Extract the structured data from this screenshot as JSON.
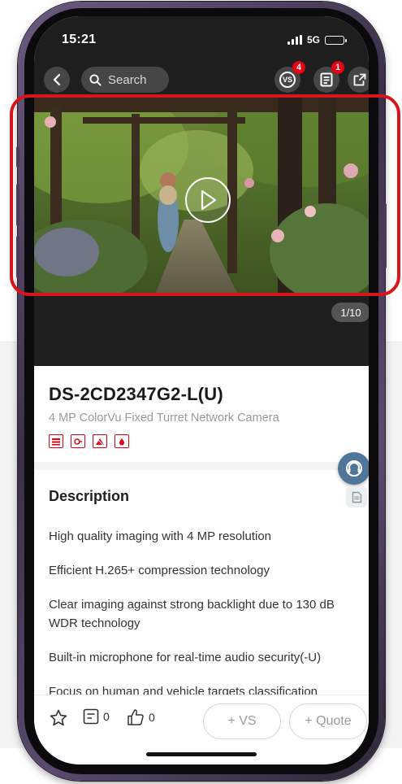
{
  "status_bar": {
    "time": "15:21",
    "network": "5G"
  },
  "nav": {
    "search_placeholder": "Search",
    "vs_badge": "4",
    "list_badge": "1"
  },
  "media": {
    "counter": "1/10"
  },
  "product": {
    "model": "DS-2CD2347G2-L(U)",
    "subtitle": "4 MP ColorVu Fixed Turret Network Camera"
  },
  "description": {
    "heading": "Description",
    "items": [
      "High quality imaging with 4 MP resolution",
      "Efficient H.265+ compression technology",
      "Clear imaging against strong backlight due to 130 dB WDR technology",
      "Built-in microphone for real-time audio security(-U)",
      "Focus on human and vehicle targets classification"
    ]
  },
  "bottom_bar": {
    "comments_count": "0",
    "likes_count": "0",
    "vs_label": "+ VS",
    "quote_label": "+ Quote"
  },
  "colors": {
    "accent_red": "#e60012",
    "highlight_red": "#d8151d",
    "support_blue": "#4f7599"
  }
}
